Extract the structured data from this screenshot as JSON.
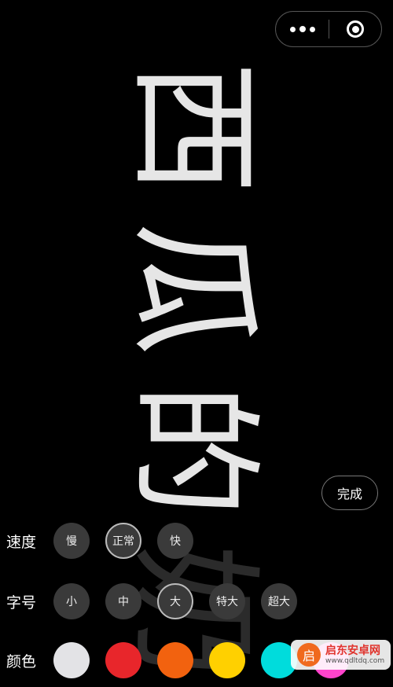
{
  "marquee": {
    "glyphs": [
      "西",
      "瓜",
      "的",
      "奶"
    ],
    "color": "#e6e6e6"
  },
  "capsule": {
    "more_icon": "more-dots-icon",
    "close_icon": "target-close-icon"
  },
  "done_label": "完成",
  "speed": {
    "label": "速度",
    "options": [
      "慢",
      "正常",
      "快"
    ],
    "selected": "正常"
  },
  "size": {
    "label": "字号",
    "options": [
      "小",
      "中",
      "大",
      "特大",
      "超大"
    ],
    "selected": "大"
  },
  "color": {
    "label": "颜色",
    "swatches": [
      "#e3e3e6",
      "#e8262b",
      "#f2620f",
      "#ffd000",
      "#00dcdc",
      "#ff44cc"
    ]
  },
  "watermark": {
    "title": "启东安卓网",
    "url": "www.qdltdq.com",
    "logo_char": "启"
  }
}
